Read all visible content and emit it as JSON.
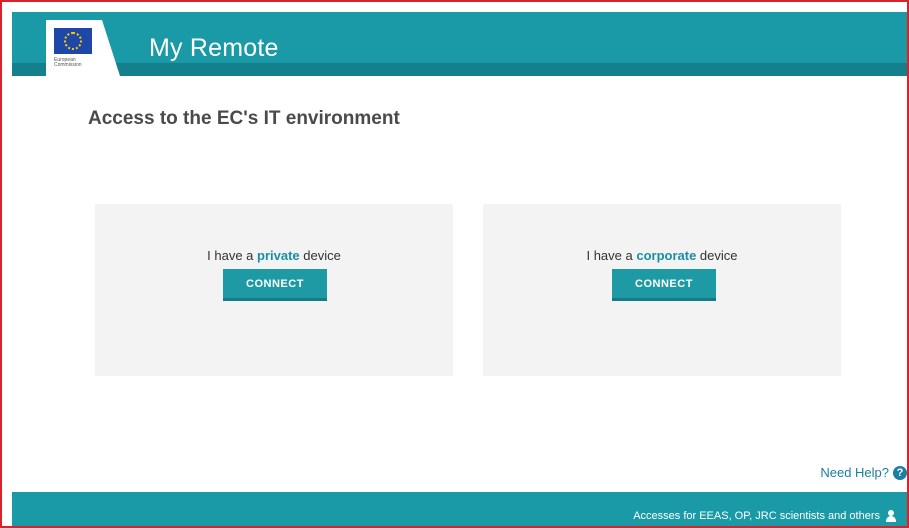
{
  "header": {
    "app_title": "My Remote",
    "logo_text": "European Commission"
  },
  "main": {
    "heading": "Access to the EC's IT environment",
    "panels": [
      {
        "prefix": "I have a ",
        "highlight": "private",
        "suffix": " device",
        "button_label": "CONNECT"
      },
      {
        "prefix": "I have a ",
        "highlight": "corporate",
        "suffix": " device",
        "button_label": "CONNECT"
      }
    ]
  },
  "help": {
    "label": "Need Help?",
    "icon": "question-circle-icon"
  },
  "footer": {
    "link_label": "Accesses for EEAS, OP, JRC scientists and others",
    "icon": "user-icon"
  },
  "colors": {
    "brand_teal": "#1a9aa6",
    "highlight": "#1a8fa3",
    "frame_border": "#d9232a",
    "panel_bg": "#f3f3f3"
  }
}
